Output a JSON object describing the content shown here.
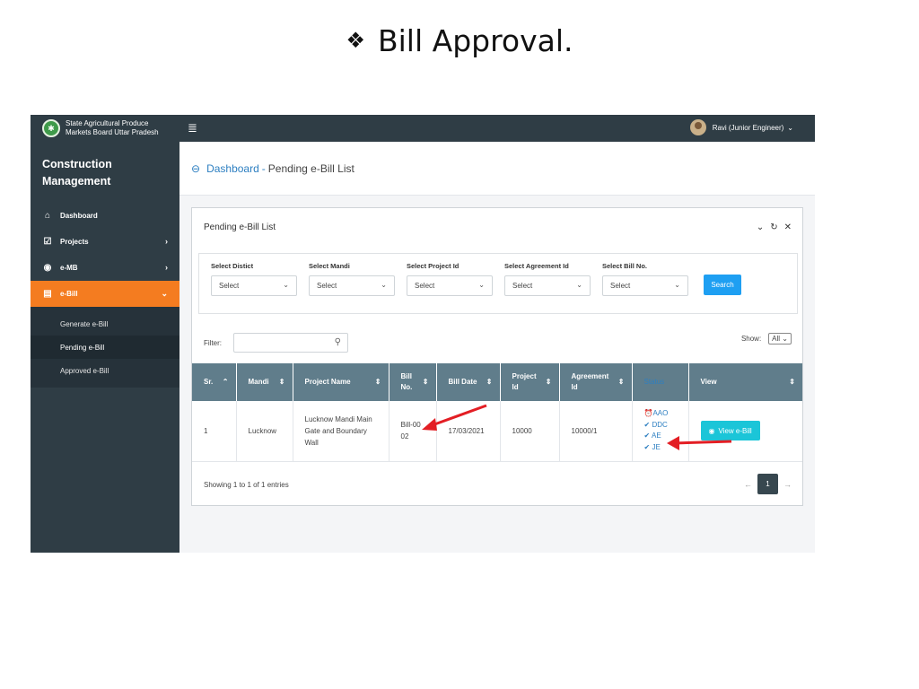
{
  "slide": {
    "bullet": "❖",
    "title": "Bill Approval."
  },
  "topbar": {
    "org_line1": "State Agricultural Produce",
    "org_line2": "Markets Board Uttar Pradesh",
    "user_label": "Ravi (Junior Engineer)"
  },
  "sidebar": {
    "title_line1": "Construction",
    "title_line2": "Management",
    "items": [
      {
        "label": "Dashboard",
        "icon": "home-icon"
      },
      {
        "label": "Projects",
        "icon": "checkbox-icon"
      },
      {
        "label": "e-MB",
        "icon": "target-icon"
      },
      {
        "label": "e-Bill",
        "icon": "clipboard-icon"
      }
    ],
    "submenu": [
      "Generate e-Bill",
      "Pending e-Bill",
      "Approved e-Bill"
    ]
  },
  "breadcrumb": {
    "home": "Dashboard",
    "sep": "-",
    "current": "Pending e-Bill List"
  },
  "card": {
    "title": "Pending e-Bill List"
  },
  "filters": [
    {
      "label": "Select Distict",
      "value": "Select"
    },
    {
      "label": "Select Mandi",
      "value": "Select"
    },
    {
      "label": "Select Project Id",
      "value": "Select"
    },
    {
      "label": "Select Agreement Id",
      "value": "Select"
    },
    {
      "label": "Select Bill No.",
      "value": "Select"
    }
  ],
  "search_label": "Search",
  "filter_label": "Filter:",
  "show_label": "Show:",
  "show_value": "All",
  "table": {
    "headers": [
      "Sr.",
      "Mandi",
      "Project Name",
      "Bill No.",
      "Bill Date",
      "Project Id",
      "Agreement Id",
      "Status",
      "View"
    ],
    "rows": [
      {
        "sr": "1",
        "mandi": "Lucknow",
        "project_name": "Lucknow Mandi Main Gate and Boundary Wall",
        "bill_no": "Bill-0002",
        "bill_date": "17/03/2021",
        "project_id": "10000",
        "agreement_id": "10000/1",
        "status": [
          "AAO",
          "DDC",
          "AE",
          "JE"
        ],
        "view_label": "View e-Bill"
      }
    ]
  },
  "footer": {
    "showing": "Showing 1 to 1 of 1 entries",
    "page": "1"
  },
  "colors": {
    "sidebar": "#2f3d45",
    "active": "#f47c20",
    "header": "#607d8b",
    "accent": "#1e9ff2",
    "arrow": "#e31e24"
  }
}
